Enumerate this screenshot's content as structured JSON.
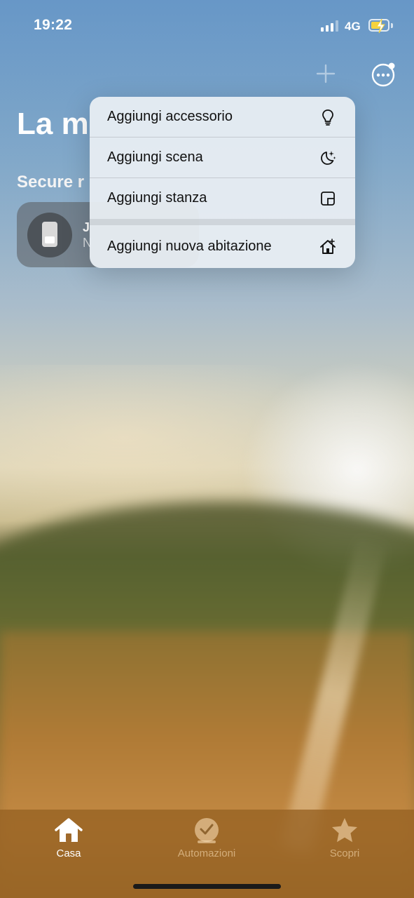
{
  "status_bar": {
    "time": "19:22",
    "network": "4G"
  },
  "page": {
    "title": "La m",
    "section": "Secure r"
  },
  "tile": {
    "name": "J",
    "status": "N"
  },
  "menu": {
    "items": [
      {
        "label": "Aggiungi accessorio",
        "icon": "lightbulb-icon"
      },
      {
        "label": "Aggiungi scena",
        "icon": "moon-sparkle-icon"
      },
      {
        "label": "Aggiungi stanza",
        "icon": "room-icon"
      },
      {
        "label": "Aggiungi nuova abitazione",
        "icon": "house-add-icon"
      }
    ]
  },
  "tabbar": {
    "tabs": [
      {
        "label": "Casa",
        "icon": "house-icon",
        "selected": true
      },
      {
        "label": "Automazioni",
        "icon": "clock-check-icon",
        "selected": false
      },
      {
        "label": "Scopri",
        "icon": "star-icon",
        "selected": false
      }
    ]
  },
  "colors": {
    "battery": "#f5d33d",
    "tab_active": "#ffffff",
    "menu_bg": "#e9eef3"
  }
}
